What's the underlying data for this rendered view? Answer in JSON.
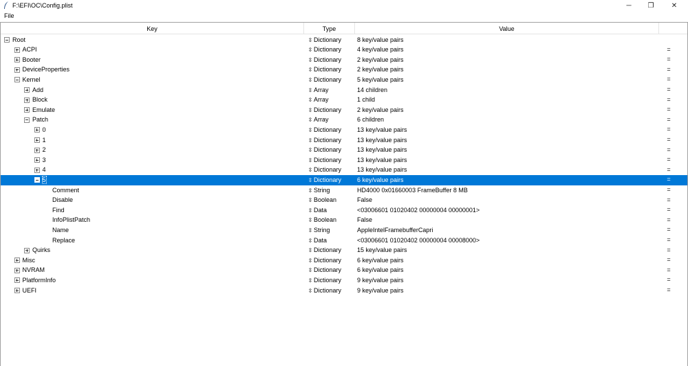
{
  "window": {
    "title": "F:\\EFI\\OC\\Config.plist",
    "minimize_glyph": "─",
    "maximize_glyph": "❐",
    "close_glyph": "✕"
  },
  "menu": {
    "file_label": "File"
  },
  "columns": {
    "key": "Key",
    "type": "Type",
    "value": "Value"
  },
  "icons": {
    "type_arrow": "⇳",
    "drag_handle": "="
  },
  "rows": [
    {
      "key": "Root",
      "type": "Dictionary",
      "value": "8 key/value pairs",
      "expander": "expanded",
      "handle": false
    },
    {
      "key": "ACPI",
      "type": "Dictionary",
      "value": "4 key/value pairs",
      "expander": "collapsed",
      "handle": true
    },
    {
      "key": "Booter",
      "type": "Dictionary",
      "value": "2 key/value pairs",
      "expander": "collapsed",
      "handle": true
    },
    {
      "key": "DeviceProperties",
      "type": "Dictionary",
      "value": "2 key/value pairs",
      "expander": "collapsed",
      "handle": true
    },
    {
      "key": "Kernel",
      "type": "Dictionary",
      "value": "5 key/value pairs",
      "expander": "expanded",
      "handle": true
    },
    {
      "key": "Add",
      "type": "Array",
      "value": "14 children",
      "expander": "collapsed",
      "handle": true
    },
    {
      "key": "Block",
      "type": "Array",
      "value": "1 child",
      "expander": "collapsed",
      "handle": true
    },
    {
      "key": "Emulate",
      "type": "Dictionary",
      "value": "2 key/value pairs",
      "expander": "collapsed",
      "handle": true
    },
    {
      "key": "Patch",
      "type": "Array",
      "value": "6 children",
      "expander": "expanded",
      "handle": true
    },
    {
      "key": "0",
      "type": "Dictionary",
      "value": "13 key/value pairs",
      "expander": "collapsed",
      "handle": true
    },
    {
      "key": "1",
      "type": "Dictionary",
      "value": "13 key/value pairs",
      "expander": "collapsed",
      "handle": true
    },
    {
      "key": "2",
      "type": "Dictionary",
      "value": "13 key/value pairs",
      "expander": "collapsed",
      "handle": true
    },
    {
      "key": "3",
      "type": "Dictionary",
      "value": "13 key/value pairs",
      "expander": "collapsed",
      "handle": true
    },
    {
      "key": "4",
      "type": "Dictionary",
      "value": "13 key/value pairs",
      "expander": "collapsed",
      "handle": true
    },
    {
      "key": "5",
      "type": "Dictionary",
      "value": "6 key/value pairs",
      "expander": "expanded",
      "handle": true,
      "selected": true
    },
    {
      "key": "Comment",
      "type": "String",
      "value": "HD4000 0x01660003 FrameBuffer 8 MB",
      "expander": "none",
      "handle": true
    },
    {
      "key": "Disable",
      "type": "Boolean",
      "value": "False",
      "expander": "none",
      "handle": true
    },
    {
      "key": "Find",
      "type": "Data",
      "value": "<03006601 01020402 00000004 00000001>",
      "expander": "none",
      "handle": true
    },
    {
      "key": "InfoPlistPatch",
      "type": "Boolean",
      "value": "False",
      "expander": "none",
      "handle": true
    },
    {
      "key": "Name",
      "type": "String",
      "value": "AppleIntelFramebufferCapri",
      "expander": "none",
      "handle": true
    },
    {
      "key": "Replace",
      "type": "Data",
      "value": "<03006601 01020402 00000004 00008000>",
      "expander": "none",
      "handle": true
    },
    {
      "key": "Quirks",
      "type": "Dictionary",
      "value": "15 key/value pairs",
      "expander": "collapsed",
      "handle": true
    },
    {
      "key": "Misc",
      "type": "Dictionary",
      "value": "6 key/value pairs",
      "expander": "collapsed",
      "handle": true
    },
    {
      "key": "NVRAM",
      "type": "Dictionary",
      "value": "6 key/value pairs",
      "expander": "collapsed",
      "handle": true
    },
    {
      "key": "PlatformInfo",
      "type": "Dictionary",
      "value": "9 key/value pairs",
      "expander": "collapsed",
      "handle": true
    },
    {
      "key": "UEFI",
      "type": "Dictionary",
      "value": "9 key/value pairs",
      "expander": "collapsed",
      "handle": true
    }
  ],
  "colors": {
    "selection": "#0078d7",
    "border": "#a0a0a0"
  }
}
